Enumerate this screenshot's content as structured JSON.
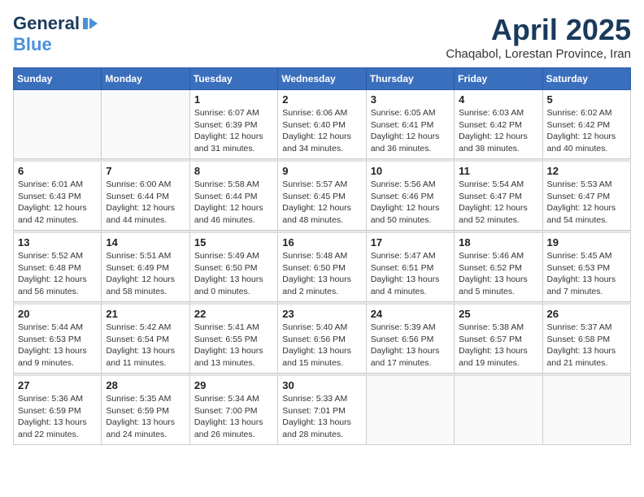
{
  "logo": {
    "general": "General",
    "blue": "Blue",
    "icon": "▶"
  },
  "title": "April 2025",
  "location": "Chaqabol, Lorestan Province, Iran",
  "days_of_week": [
    "Sunday",
    "Monday",
    "Tuesday",
    "Wednesday",
    "Thursday",
    "Friday",
    "Saturday"
  ],
  "weeks": [
    [
      {
        "day": "",
        "sunrise": "",
        "sunset": "",
        "daylight": ""
      },
      {
        "day": "",
        "sunrise": "",
        "sunset": "",
        "daylight": ""
      },
      {
        "day": "1",
        "sunrise": "Sunrise: 6:07 AM",
        "sunset": "Sunset: 6:39 PM",
        "daylight": "Daylight: 12 hours and 31 minutes."
      },
      {
        "day": "2",
        "sunrise": "Sunrise: 6:06 AM",
        "sunset": "Sunset: 6:40 PM",
        "daylight": "Daylight: 12 hours and 34 minutes."
      },
      {
        "day": "3",
        "sunrise": "Sunrise: 6:05 AM",
        "sunset": "Sunset: 6:41 PM",
        "daylight": "Daylight: 12 hours and 36 minutes."
      },
      {
        "day": "4",
        "sunrise": "Sunrise: 6:03 AM",
        "sunset": "Sunset: 6:42 PM",
        "daylight": "Daylight: 12 hours and 38 minutes."
      },
      {
        "day": "5",
        "sunrise": "Sunrise: 6:02 AM",
        "sunset": "Sunset: 6:42 PM",
        "daylight": "Daylight: 12 hours and 40 minutes."
      }
    ],
    [
      {
        "day": "6",
        "sunrise": "Sunrise: 6:01 AM",
        "sunset": "Sunset: 6:43 PM",
        "daylight": "Daylight: 12 hours and 42 minutes."
      },
      {
        "day": "7",
        "sunrise": "Sunrise: 6:00 AM",
        "sunset": "Sunset: 6:44 PM",
        "daylight": "Daylight: 12 hours and 44 minutes."
      },
      {
        "day": "8",
        "sunrise": "Sunrise: 5:58 AM",
        "sunset": "Sunset: 6:44 PM",
        "daylight": "Daylight: 12 hours and 46 minutes."
      },
      {
        "day": "9",
        "sunrise": "Sunrise: 5:57 AM",
        "sunset": "Sunset: 6:45 PM",
        "daylight": "Daylight: 12 hours and 48 minutes."
      },
      {
        "day": "10",
        "sunrise": "Sunrise: 5:56 AM",
        "sunset": "Sunset: 6:46 PM",
        "daylight": "Daylight: 12 hours and 50 minutes."
      },
      {
        "day": "11",
        "sunrise": "Sunrise: 5:54 AM",
        "sunset": "Sunset: 6:47 PM",
        "daylight": "Daylight: 12 hours and 52 minutes."
      },
      {
        "day": "12",
        "sunrise": "Sunrise: 5:53 AM",
        "sunset": "Sunset: 6:47 PM",
        "daylight": "Daylight: 12 hours and 54 minutes."
      }
    ],
    [
      {
        "day": "13",
        "sunrise": "Sunrise: 5:52 AM",
        "sunset": "Sunset: 6:48 PM",
        "daylight": "Daylight: 12 hours and 56 minutes."
      },
      {
        "day": "14",
        "sunrise": "Sunrise: 5:51 AM",
        "sunset": "Sunset: 6:49 PM",
        "daylight": "Daylight: 12 hours and 58 minutes."
      },
      {
        "day": "15",
        "sunrise": "Sunrise: 5:49 AM",
        "sunset": "Sunset: 6:50 PM",
        "daylight": "Daylight: 13 hours and 0 minutes."
      },
      {
        "day": "16",
        "sunrise": "Sunrise: 5:48 AM",
        "sunset": "Sunset: 6:50 PM",
        "daylight": "Daylight: 13 hours and 2 minutes."
      },
      {
        "day": "17",
        "sunrise": "Sunrise: 5:47 AM",
        "sunset": "Sunset: 6:51 PM",
        "daylight": "Daylight: 13 hours and 4 minutes."
      },
      {
        "day": "18",
        "sunrise": "Sunrise: 5:46 AM",
        "sunset": "Sunset: 6:52 PM",
        "daylight": "Daylight: 13 hours and 5 minutes."
      },
      {
        "day": "19",
        "sunrise": "Sunrise: 5:45 AM",
        "sunset": "Sunset: 6:53 PM",
        "daylight": "Daylight: 13 hours and 7 minutes."
      }
    ],
    [
      {
        "day": "20",
        "sunrise": "Sunrise: 5:44 AM",
        "sunset": "Sunset: 6:53 PM",
        "daylight": "Daylight: 13 hours and 9 minutes."
      },
      {
        "day": "21",
        "sunrise": "Sunrise: 5:42 AM",
        "sunset": "Sunset: 6:54 PM",
        "daylight": "Daylight: 13 hours and 11 minutes."
      },
      {
        "day": "22",
        "sunrise": "Sunrise: 5:41 AM",
        "sunset": "Sunset: 6:55 PM",
        "daylight": "Daylight: 13 hours and 13 minutes."
      },
      {
        "day": "23",
        "sunrise": "Sunrise: 5:40 AM",
        "sunset": "Sunset: 6:56 PM",
        "daylight": "Daylight: 13 hours and 15 minutes."
      },
      {
        "day": "24",
        "sunrise": "Sunrise: 5:39 AM",
        "sunset": "Sunset: 6:56 PM",
        "daylight": "Daylight: 13 hours and 17 minutes."
      },
      {
        "day": "25",
        "sunrise": "Sunrise: 5:38 AM",
        "sunset": "Sunset: 6:57 PM",
        "daylight": "Daylight: 13 hours and 19 minutes."
      },
      {
        "day": "26",
        "sunrise": "Sunrise: 5:37 AM",
        "sunset": "Sunset: 6:58 PM",
        "daylight": "Daylight: 13 hours and 21 minutes."
      }
    ],
    [
      {
        "day": "27",
        "sunrise": "Sunrise: 5:36 AM",
        "sunset": "Sunset: 6:59 PM",
        "daylight": "Daylight: 13 hours and 22 minutes."
      },
      {
        "day": "28",
        "sunrise": "Sunrise: 5:35 AM",
        "sunset": "Sunset: 6:59 PM",
        "daylight": "Daylight: 13 hours and 24 minutes."
      },
      {
        "day": "29",
        "sunrise": "Sunrise: 5:34 AM",
        "sunset": "Sunset: 7:00 PM",
        "daylight": "Daylight: 13 hours and 26 minutes."
      },
      {
        "day": "30",
        "sunrise": "Sunrise: 5:33 AM",
        "sunset": "Sunset: 7:01 PM",
        "daylight": "Daylight: 13 hours and 28 minutes."
      },
      {
        "day": "",
        "sunrise": "",
        "sunset": "",
        "daylight": ""
      },
      {
        "day": "",
        "sunrise": "",
        "sunset": "",
        "daylight": ""
      },
      {
        "day": "",
        "sunrise": "",
        "sunset": "",
        "daylight": ""
      }
    ]
  ]
}
